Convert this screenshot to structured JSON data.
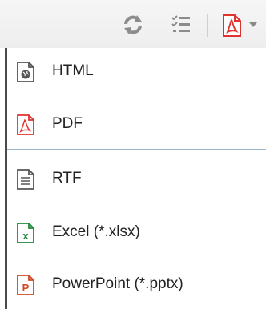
{
  "toolbar": {
    "icons": [
      "refresh-icon",
      "list-icon",
      "pdf-export-icon",
      "caret-down-icon"
    ]
  },
  "menu": {
    "items": [
      {
        "label": "HTML",
        "icon": "html-file-icon"
      },
      {
        "label": "PDF",
        "icon": "pdf-file-icon"
      },
      {
        "label": "RTF",
        "icon": "rtf-file-icon"
      },
      {
        "label": "Excel (*.xlsx)",
        "icon": "excel-file-icon"
      },
      {
        "label": "PowerPoint (*.pptx)",
        "icon": "powerpoint-file-icon"
      }
    ]
  },
  "colors": {
    "pdf_red": "#e0322f",
    "excel_green": "#1f8a3b",
    "ppt_red": "#d24726",
    "divider": "#9ab6c9"
  }
}
